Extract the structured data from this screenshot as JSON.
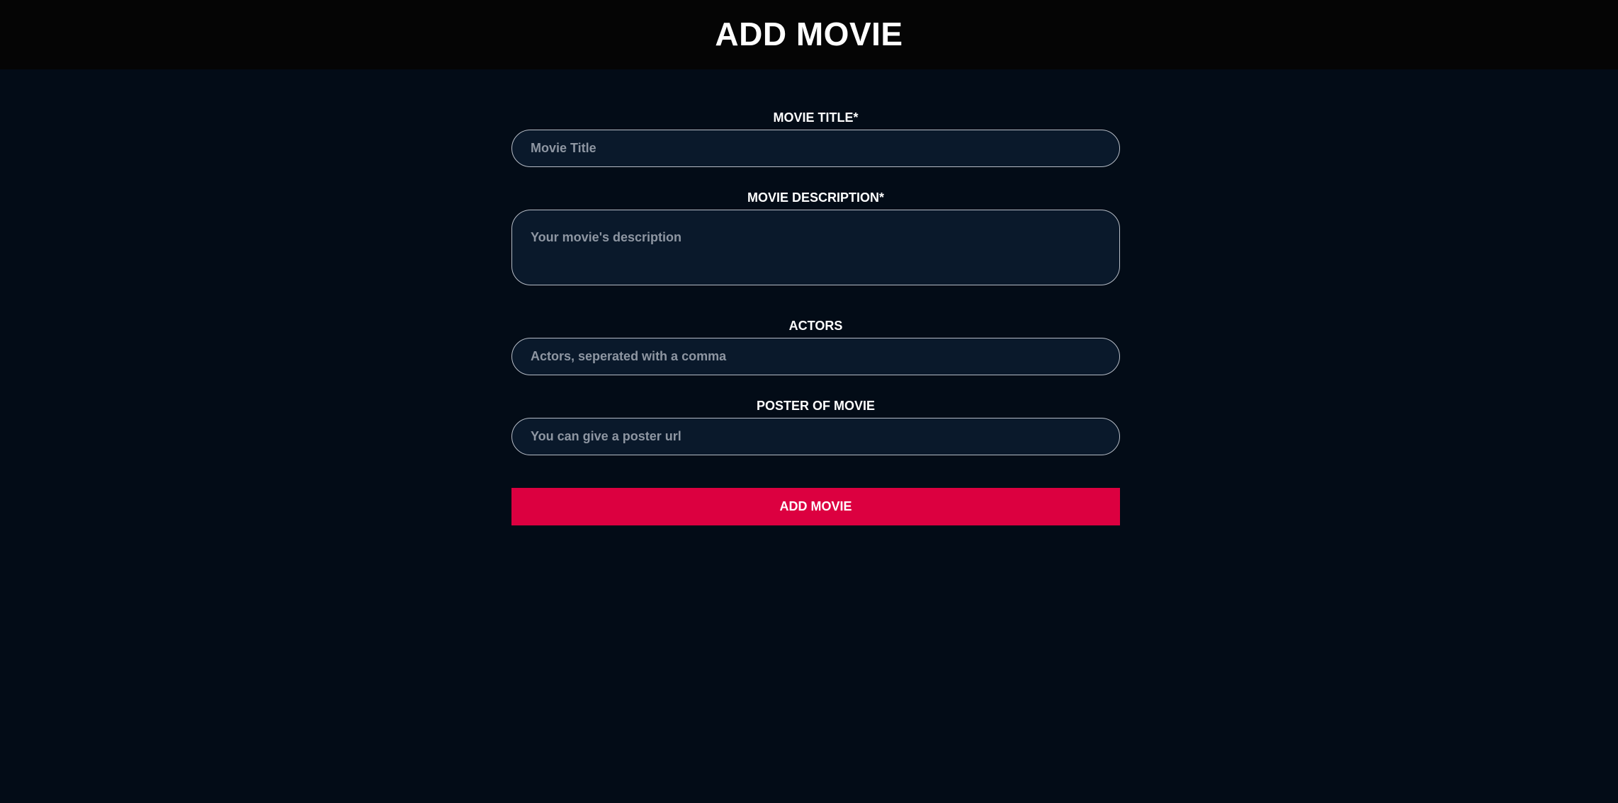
{
  "header": {
    "title": "ADD MOVIE"
  },
  "form": {
    "title_field": {
      "label": "MOVIE TITLE*",
      "placeholder": "Movie Title",
      "value": ""
    },
    "description_field": {
      "label": "MOVIE DESCRIPTION*",
      "placeholder": "Your movie's description",
      "value": ""
    },
    "actors_field": {
      "label": "ACTORS",
      "placeholder": "Actors, seperated with a comma",
      "value": ""
    },
    "poster_field": {
      "label": "POSTER OF MOVIE",
      "placeholder": "You can give a poster url",
      "value": ""
    },
    "submit_label": "ADD MOVIE"
  },
  "colors": {
    "page_background": "#030c17",
    "header_background": "#050505",
    "input_background": "#0a192b",
    "input_border": "#b6bcc6",
    "button_accent": "#dc0040",
    "text": "#ffffff"
  }
}
